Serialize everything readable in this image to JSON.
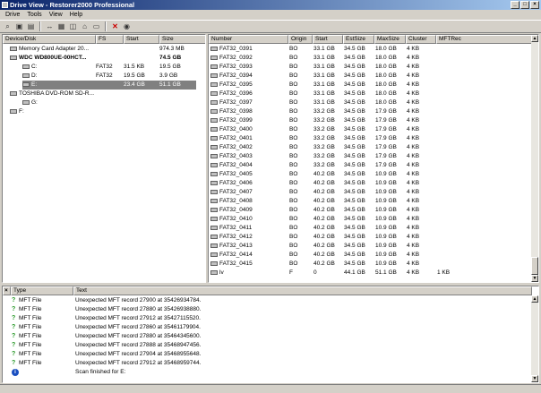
{
  "window": {
    "title": "Drive View - Restorer2000 Professional"
  },
  "menu": [
    "Drive",
    "Tools",
    "View",
    "Help"
  ],
  "toolbar_icons": [
    "scan-icon",
    "open-icon",
    "print-icon",
    "arrows-icon",
    "save-icon",
    "disk-icon",
    "folder-icon",
    "export-icon",
    "delete-icon",
    "properties-icon"
  ],
  "drives": {
    "columns": [
      "Device/Disk",
      "FS",
      "Start",
      "Size"
    ],
    "rows": [
      {
        "name": "Memory Card Adapter 20...",
        "fs": "",
        "start": "",
        "size": "974.3 MB",
        "indent": 0,
        "bold": false
      },
      {
        "name": "WDC WD800UE-00HCT...",
        "fs": "",
        "start": "",
        "size": "74.5 GB",
        "indent": 0,
        "bold": true
      },
      {
        "name": "C:",
        "fs": "FAT32",
        "start": "31.5 KB",
        "size": "19.5 GB",
        "indent": 1,
        "bold": false
      },
      {
        "name": "D:",
        "fs": "FAT32",
        "start": "19.5 GB",
        "size": "3.9 GB",
        "indent": 1,
        "bold": false
      },
      {
        "name": "E:",
        "fs": "",
        "start": "23.4 GB",
        "size": "51.1 GB",
        "indent": 1,
        "bold": false,
        "selected": true
      },
      {
        "name": "TOSHIBA DVD-ROM SD-R...",
        "fs": "",
        "start": "",
        "size": "",
        "indent": 0,
        "bold": false
      },
      {
        "name": "G:",
        "fs": "",
        "start": "",
        "size": "",
        "indent": 1,
        "bold": false
      },
      {
        "name": "F:",
        "fs": "",
        "start": "",
        "size": "",
        "indent": 0,
        "bold": false
      }
    ]
  },
  "volumes": {
    "columns": [
      "Number",
      "Origin",
      "Start",
      "EstSize",
      "MaxSize",
      "Cluster",
      "MFTRec"
    ],
    "rows": [
      [
        "FAT32_0391",
        "BO",
        "33.1 GB",
        "34.5 GB",
        "18.0 GB",
        "4 KB",
        ""
      ],
      [
        "FAT32_0392",
        "BO",
        "33.1 GB",
        "34.5 GB",
        "18.0 GB",
        "4 KB",
        ""
      ],
      [
        "FAT32_0393",
        "BO",
        "33.1 GB",
        "34.5 GB",
        "18.0 GB",
        "4 KB",
        ""
      ],
      [
        "FAT32_0394",
        "BO",
        "33.1 GB",
        "34.5 GB",
        "18.0 GB",
        "4 KB",
        ""
      ],
      [
        "FAT32_0395",
        "BO",
        "33.1 GB",
        "34.5 GB",
        "18.0 GB",
        "4 KB",
        ""
      ],
      [
        "FAT32_0396",
        "BO",
        "33.1 GB",
        "34.5 GB",
        "18.0 GB",
        "4 KB",
        ""
      ],
      [
        "FAT32_0397",
        "BO",
        "33.1 GB",
        "34.5 GB",
        "18.0 GB",
        "4 KB",
        ""
      ],
      [
        "FAT32_0398",
        "BO",
        "33.2 GB",
        "34.5 GB",
        "17.9 GB",
        "4 KB",
        ""
      ],
      [
        "FAT32_0399",
        "BO",
        "33.2 GB",
        "34.5 GB",
        "17.9 GB",
        "4 KB",
        ""
      ],
      [
        "FAT32_0400",
        "BO",
        "33.2 GB",
        "34.5 GB",
        "17.9 GB",
        "4 KB",
        ""
      ],
      [
        "FAT32_0401",
        "BO",
        "33.2 GB",
        "34.5 GB",
        "17.9 GB",
        "4 KB",
        ""
      ],
      [
        "FAT32_0402",
        "BO",
        "33.2 GB",
        "34.5 GB",
        "17.9 GB",
        "4 KB",
        ""
      ],
      [
        "FAT32_0403",
        "BO",
        "33.2 GB",
        "34.5 GB",
        "17.9 GB",
        "4 KB",
        ""
      ],
      [
        "FAT32_0404",
        "BO",
        "33.2 GB",
        "34.5 GB",
        "17.9 GB",
        "4 KB",
        ""
      ],
      [
        "FAT32_0405",
        "BO",
        "40.2 GB",
        "34.5 GB",
        "10.9 GB",
        "4 KB",
        ""
      ],
      [
        "FAT32_0406",
        "BO",
        "40.2 GB",
        "34.5 GB",
        "10.9 GB",
        "4 KB",
        ""
      ],
      [
        "FAT32_0407",
        "BO",
        "40.2 GB",
        "34.5 GB",
        "10.9 GB",
        "4 KB",
        ""
      ],
      [
        "FAT32_0408",
        "BO",
        "40.2 GB",
        "34.5 GB",
        "10.9 GB",
        "4 KB",
        ""
      ],
      [
        "FAT32_0409",
        "BO",
        "40.2 GB",
        "34.5 GB",
        "10.9 GB",
        "4 KB",
        ""
      ],
      [
        "FAT32_0410",
        "BO",
        "40.2 GB",
        "34.5 GB",
        "10.9 GB",
        "4 KB",
        ""
      ],
      [
        "FAT32_0411",
        "BO",
        "40.2 GB",
        "34.5 GB",
        "10.9 GB",
        "4 KB",
        ""
      ],
      [
        "FAT32_0412",
        "BO",
        "40.2 GB",
        "34.5 GB",
        "10.9 GB",
        "4 KB",
        ""
      ],
      [
        "FAT32_0413",
        "BO",
        "40.2 GB",
        "34.5 GB",
        "10.9 GB",
        "4 KB",
        ""
      ],
      [
        "FAT32_0414",
        "BO",
        "40.2 GB",
        "34.5 GB",
        "10.9 GB",
        "4 KB",
        ""
      ],
      [
        "FAT32_0415",
        "BO",
        "40.2 GB",
        "34.5 GB",
        "10.9 GB",
        "4 KB",
        ""
      ],
      [
        "lv",
        "F",
        "0",
        "44.1 GB",
        "51.1 GB",
        "4 KB",
        "1 KB"
      ]
    ]
  },
  "log": {
    "columns": [
      "Type",
      "Text"
    ],
    "rows": [
      {
        "type": "MFT File",
        "icon": "question",
        "text": "Unexpected MFT record 27900 at 35426934784."
      },
      {
        "type": "MFT File",
        "icon": "question",
        "text": "Unexpected MFT record 27880 at 35426938880."
      },
      {
        "type": "MFT File",
        "icon": "question",
        "text": "Unexpected MFT record 27912 at 35427115520."
      },
      {
        "type": "MFT File",
        "icon": "question",
        "text": "Unexpected MFT record 27860 at 35461179904."
      },
      {
        "type": "MFT File",
        "icon": "question",
        "text": "Unexpected MFT record 27880 at 35464345600."
      },
      {
        "type": "MFT File",
        "icon": "question",
        "text": "Unexpected MFT record 27888 at 35468947456."
      },
      {
        "type": "MFT File",
        "icon": "question",
        "text": "Unexpected MFT record 27904 at 35468955648."
      },
      {
        "type": "MFT File",
        "icon": "question",
        "text": "Unexpected MFT record 27912 at 35468959744."
      },
      {
        "type": "",
        "icon": "info",
        "text": "Scan finished for E:"
      }
    ]
  }
}
